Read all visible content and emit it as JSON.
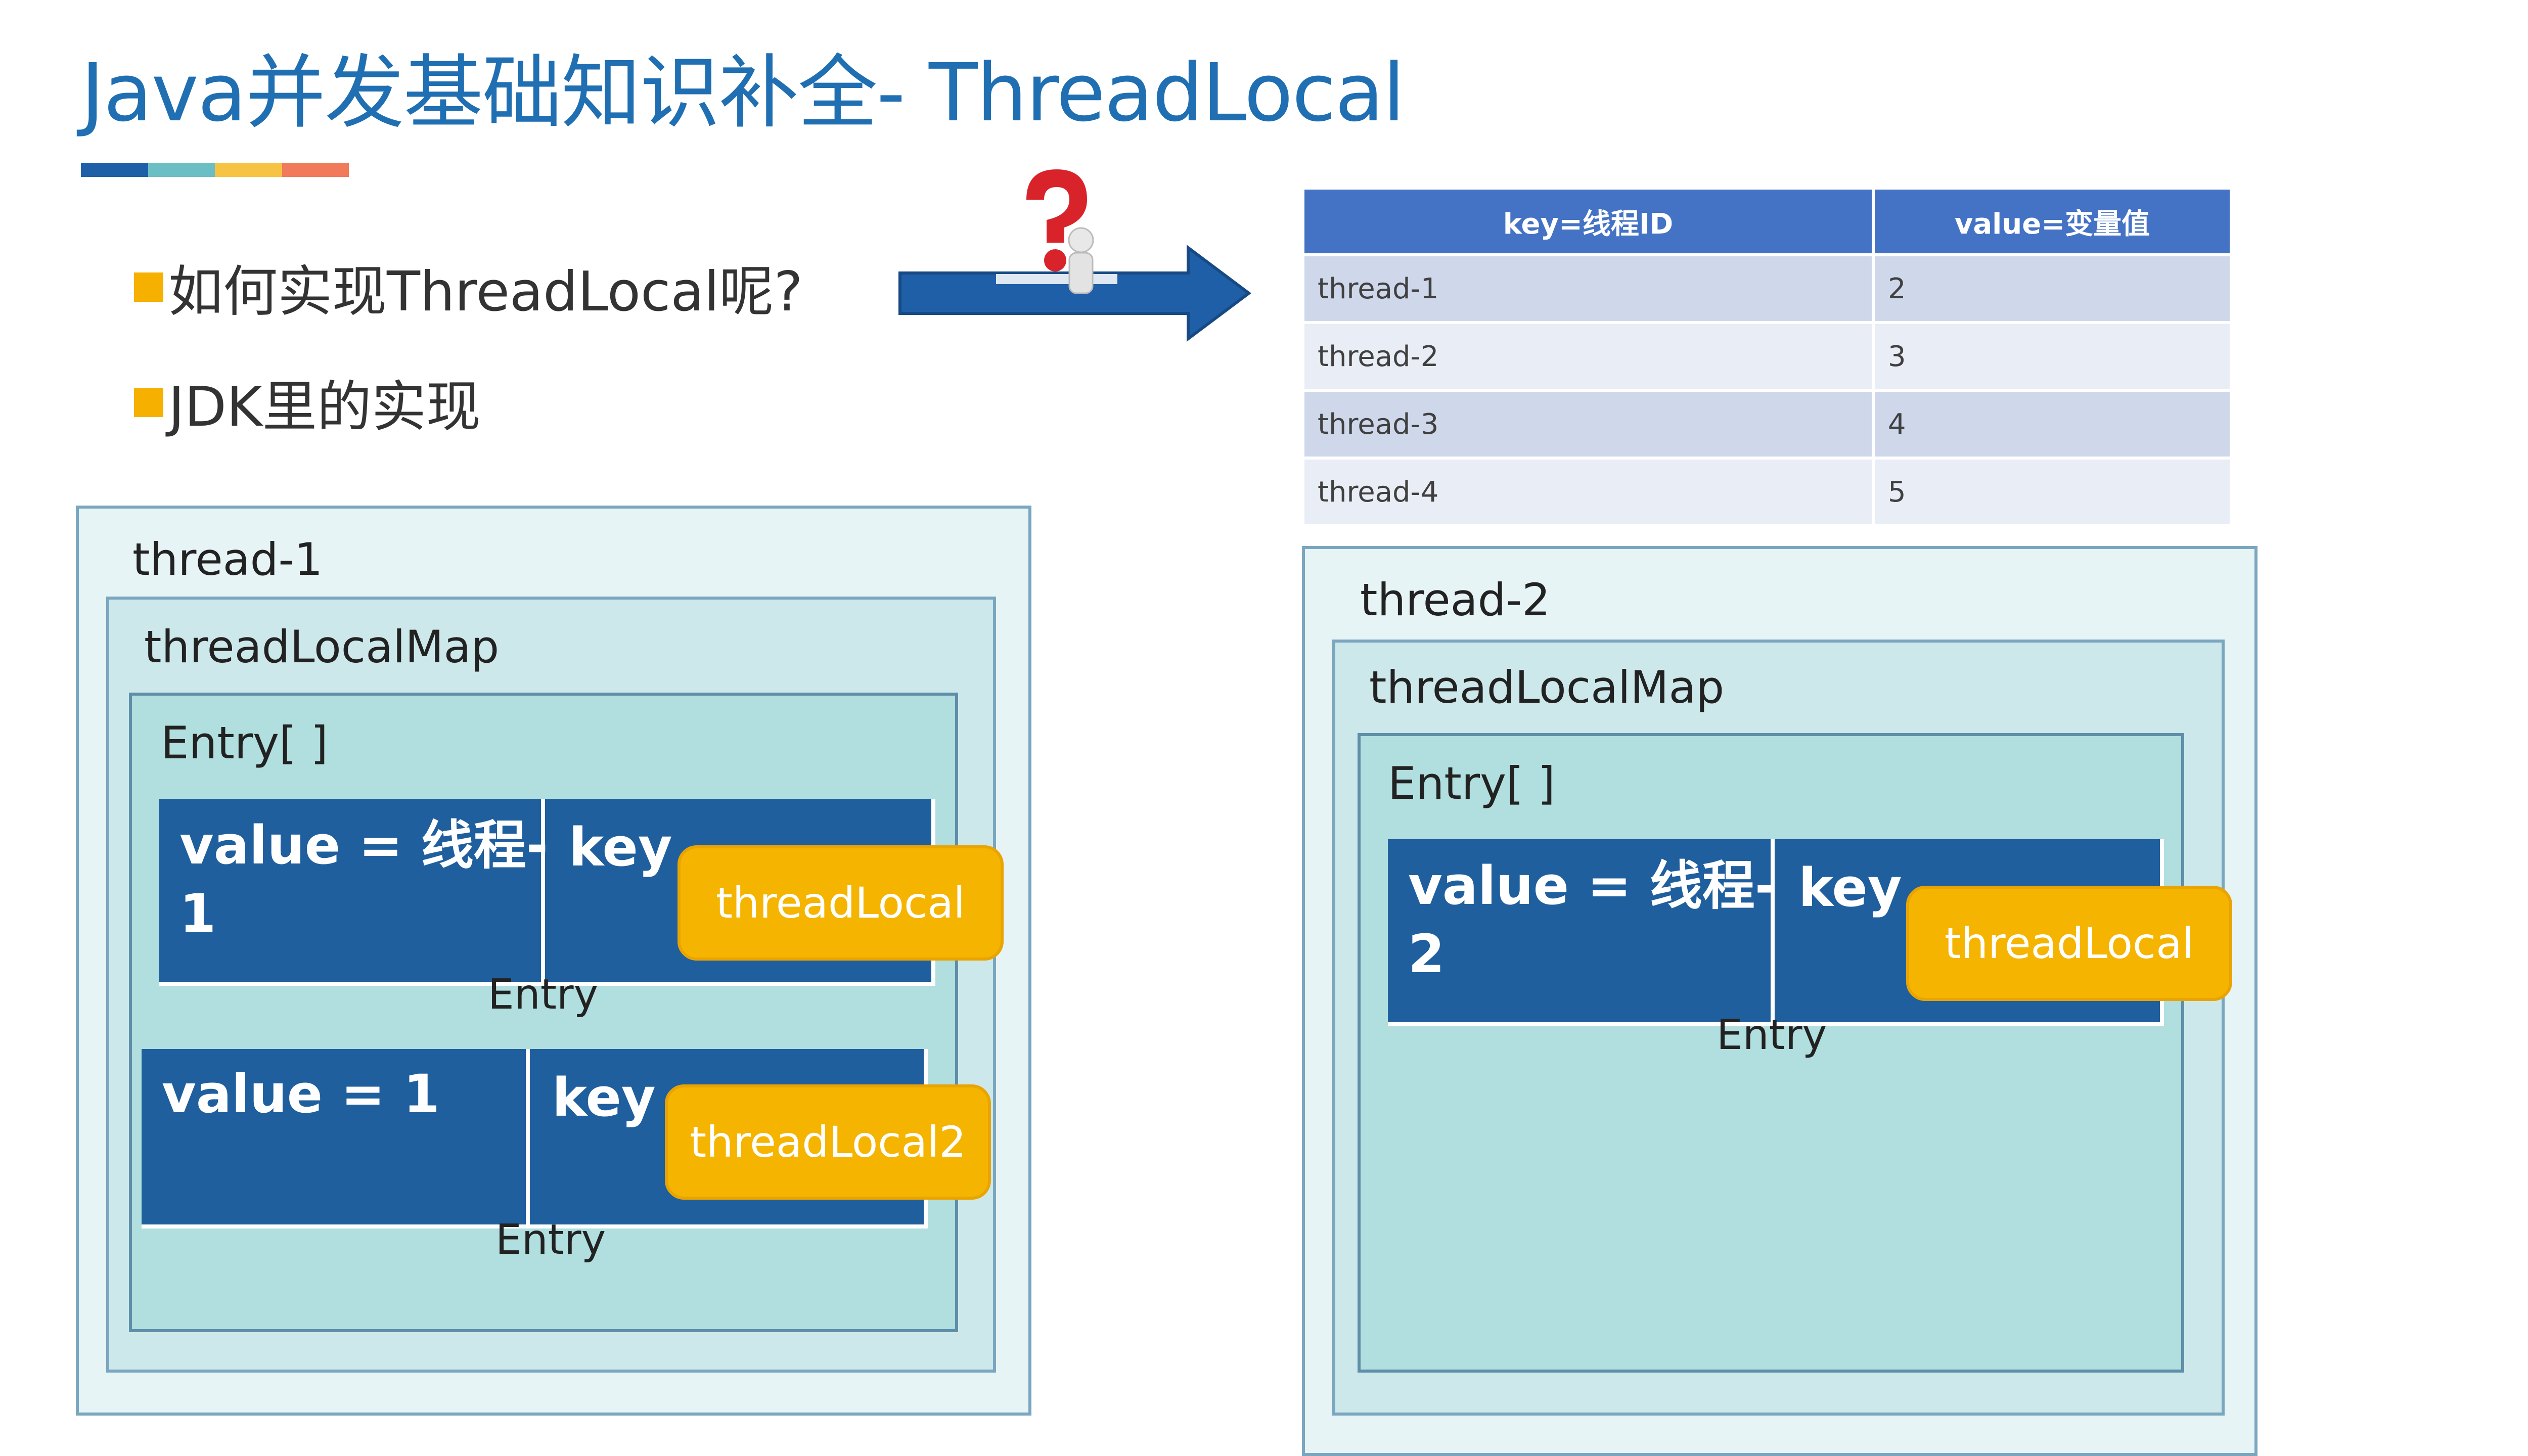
{
  "title": "Java并发基础知识补全- ThreadLocal",
  "title_bar_colors": [
    "#1f5fa8",
    "#6bbfc4",
    "#f7c343",
    "#f07a5a"
  ],
  "bullets": [
    "如何实现ThreadLocal呢?",
    "JDK里的实现"
  ],
  "colors": {
    "accent_yellow": "#f5b400",
    "entry_blue": "#1f5f9e",
    "table_header": "#4472c4"
  },
  "table": {
    "headers": [
      "key=线程ID",
      "value=变量值"
    ],
    "rows": [
      [
        "thread-1",
        "2"
      ],
      [
        "thread-2",
        "3"
      ],
      [
        "thread-3",
        "4"
      ],
      [
        "thread-4",
        "5"
      ]
    ]
  },
  "left": {
    "thread_label": "thread-1",
    "map_label": "threadLocalMap",
    "array_label": "Entry[ ]",
    "entries": [
      {
        "value_line1": "value = 线程-",
        "value_line2": "1",
        "key": "key",
        "ref": "threadLocal",
        "label": "Entry"
      },
      {
        "value_line1": "value = 1",
        "value_line2": "",
        "key": "key",
        "ref": "threadLocal2",
        "label": "Entry"
      }
    ]
  },
  "right": {
    "thread_label": "thread-2",
    "map_label": "threadLocalMap",
    "array_label": "Entry[ ]",
    "entries": [
      {
        "value_line1": "value = 线程-",
        "value_line2": "2",
        "key": "key",
        "ref": "threadLocal",
        "label": "Entry"
      }
    ]
  }
}
